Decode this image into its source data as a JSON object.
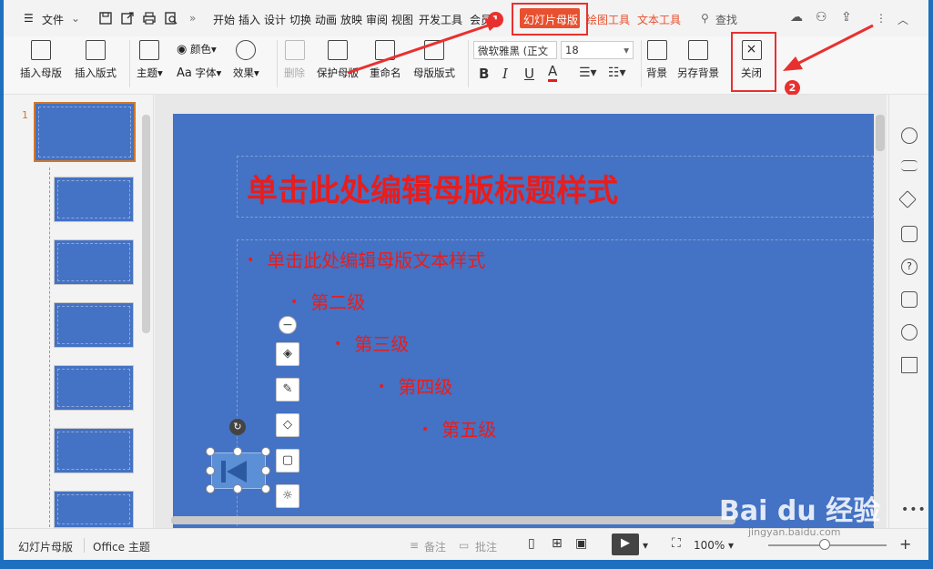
{
  "topbar": {
    "file": "文件",
    "tabs": [
      "开始",
      "插入",
      "设计",
      "切换",
      "动画",
      "放映",
      "审阅",
      "视图",
      "开发工具",
      "会员",
      "幻灯片母版",
      "绘图工具",
      "文本工具"
    ],
    "search": "查找",
    "active_tab_color": "#e8502f",
    "tool_tab_color": "#e8502f"
  },
  "ribbon": {
    "insert_master": "插入母版",
    "insert_layout": "插入版式",
    "theme": "主题",
    "color": "颜色",
    "font": "字体",
    "effects": "效果",
    "delete": "删除",
    "protect_master": "保护母版",
    "rename": "重命名",
    "master_layout": "母版版式",
    "font_name": "微软雅黑 (正文",
    "font_size": "18",
    "bold": "B",
    "italic": "I",
    "underline": "U",
    "font_color": "A",
    "background": "背景",
    "save_background": "另存背景",
    "close": "关闭"
  },
  "slides": {
    "selected_number": "1"
  },
  "slide": {
    "title": "单击此处编辑母版标题样式",
    "levels": [
      "单击此处编辑母版文本样式",
      "第二级",
      "第三级",
      "第四级",
      "第五级"
    ],
    "bg_color": "#4472c4",
    "text_color": "#e81d1d"
  },
  "status": {
    "view_name": "幻灯片母版",
    "theme_name": "Office 主题",
    "notes": "备注",
    "comments": "批注",
    "zoom": "100%"
  },
  "annotations": {
    "badge1": "1",
    "badge2": "2",
    "color": "#e8312f"
  },
  "watermark": {
    "main": "Bai du 经验",
    "sub": "jingyan.baidu.com"
  }
}
